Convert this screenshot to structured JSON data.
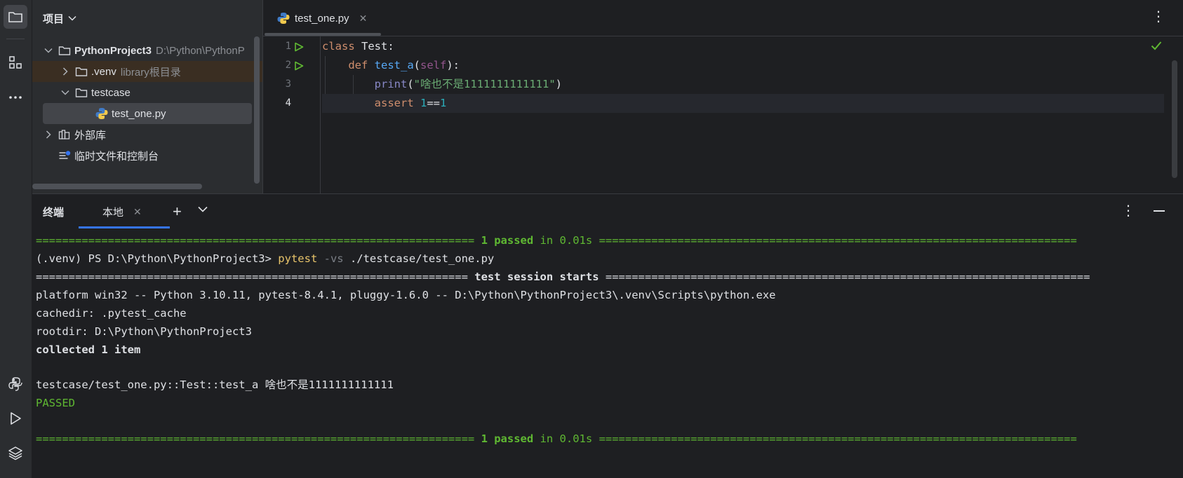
{
  "project_panel": {
    "title": "项目",
    "tree": [
      {
        "label": "PythonProject3",
        "hint": "D:\\Python\\PythonP"
      },
      {
        "label": ".venv",
        "hint": "library根目录"
      },
      {
        "label": "testcase"
      },
      {
        "label": "test_one.py"
      },
      {
        "label": "外部库"
      },
      {
        "label": "临时文件和控制台"
      }
    ]
  },
  "editor": {
    "tab_label": "test_one.py",
    "line_numbers": [
      "1",
      "2",
      "3",
      "4"
    ],
    "code": {
      "l1_kw": "class",
      "l1_rest": " Test:",
      "l2_indent": "    ",
      "l2_kw": "def",
      "l2_fn": "test_a",
      "l2_open": "(",
      "l2_self": "self",
      "l2_close": "):",
      "l3_indent": "        ",
      "l3_fn": "print",
      "l3_open": "(",
      "l3_str": "\"啥也不是1111111111111\"",
      "l3_close": ")",
      "l4_indent": "        ",
      "l4_kw": "assert",
      "l4_n1": "1",
      "l4_op": "==",
      "l4_n2": "1"
    }
  },
  "terminal": {
    "title": "终端",
    "tab_label": "本地",
    "lines": {
      "l1_eq_left": "===================================================================",
      "l1_mid": " 1 passed",
      "l1_time": " in 0.01s ",
      "l1_eq_right": "=========================================================================",
      "l2_prompt": "(.venv) PS D:\\Python\\PythonProject3> ",
      "l2_cmd": "pytest",
      "l2_flag": " -vs",
      "l2_arg": " ./testcase/test_one.py",
      "l3_eq_left": "================================================================== ",
      "l3_mid": "test session starts",
      "l3_eq_right": " ==========================================================================",
      "l4": "platform win32 -- Python 3.10.11, pytest-8.4.1, pluggy-1.6.0 -- D:\\Python\\PythonProject3\\.venv\\Scripts\\python.exe",
      "l5": "cachedir: .pytest_cache",
      "l6": "rootdir: D:\\Python\\PythonProject3",
      "l7": "collected 1 item",
      "l8": "testcase/test_one.py::Test::test_a 啥也不是1111111111111",
      "l9": "PASSED",
      "l10_eq_left": "===================================================================",
      "l10_mid": " 1 passed",
      "l10_time": " in 0.01s ",
      "l10_eq_right": "========================================================================="
    }
  },
  "icons": {
    "folder": "folder-icon",
    "structure": "structure-icon",
    "more": "more-icon",
    "python_console": "python-console-icon",
    "run": "run-icon",
    "layers": "layers-icon"
  },
  "colors": {
    "accent": "#3574f0",
    "pass_green": "#5fb832",
    "keyword": "#cf8e6d",
    "function": "#56a8f5",
    "string": "#6aab73"
  }
}
